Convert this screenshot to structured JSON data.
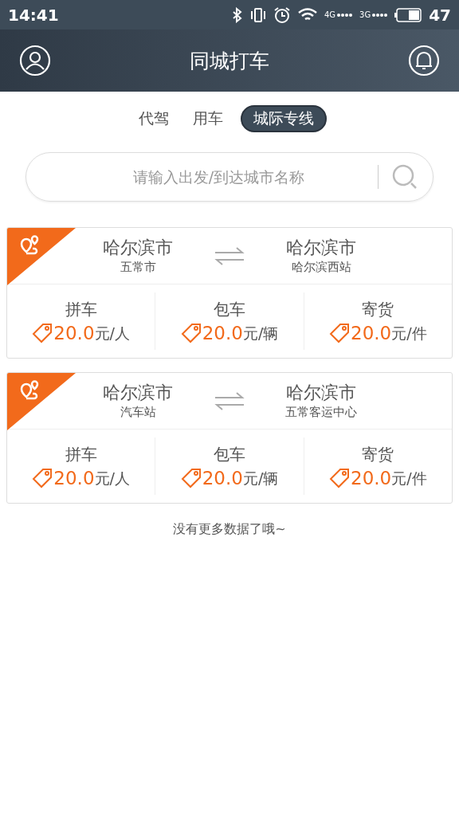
{
  "status_bar": {
    "time": "14:41",
    "networks": [
      "4G",
      "3G"
    ],
    "battery": "47"
  },
  "header": {
    "title": "同城打车"
  },
  "tabs": [
    {
      "label": "代驾",
      "selected": false
    },
    {
      "label": "用车",
      "selected": false
    },
    {
      "label": "城际专线",
      "selected": true
    }
  ],
  "search": {
    "placeholder": "请输入出发/到达城市名称"
  },
  "routes": [
    {
      "from": {
        "city": "哈尔滨市",
        "stop": "五常市"
      },
      "to": {
        "city": "哈尔滨市",
        "stop": "哈尔滨西站"
      },
      "services": [
        {
          "name": "拼车",
          "amount": "20.0",
          "unit": "元/人"
        },
        {
          "name": "包车",
          "amount": "20.0",
          "unit": "元/辆"
        },
        {
          "name": "寄货",
          "amount": "20.0",
          "unit": "元/件"
        }
      ]
    },
    {
      "from": {
        "city": "哈尔滨市",
        "stop": "汽车站"
      },
      "to": {
        "city": "哈尔滨市",
        "stop": "五常客运中心"
      },
      "services": [
        {
          "name": "拼车",
          "amount": "20.0",
          "unit": "元/人"
        },
        {
          "name": "包车",
          "amount": "20.0",
          "unit": "元/辆"
        },
        {
          "name": "寄货",
          "amount": "20.0",
          "unit": "元/件"
        }
      ]
    }
  ],
  "footer": "没有更多数据了哦~"
}
